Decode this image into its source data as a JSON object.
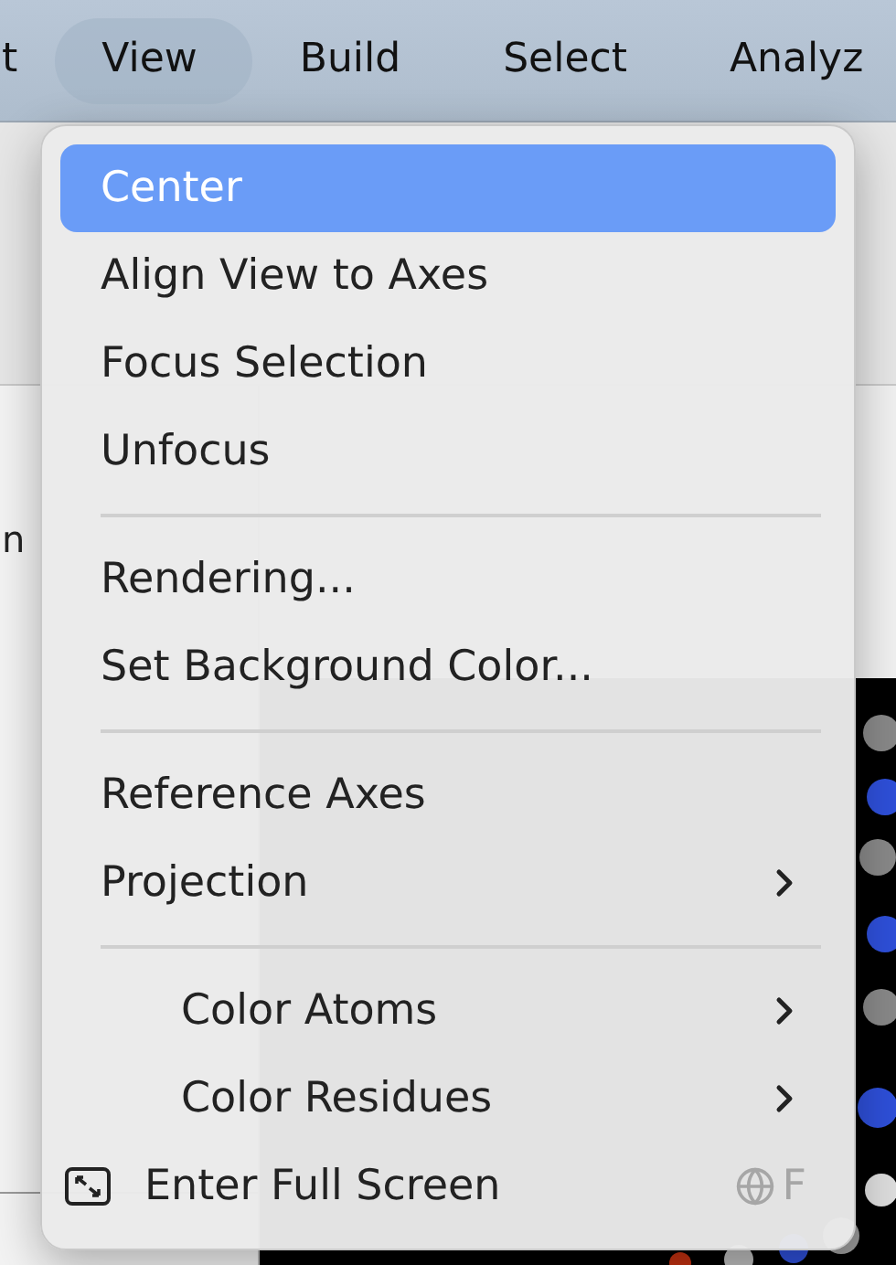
{
  "menubar": [
    {
      "label": "t",
      "selected": false
    },
    {
      "label": "View",
      "selected": true
    },
    {
      "label": "Build",
      "selected": false
    },
    {
      "label": "Select",
      "selected": false
    },
    {
      "label": "Analyz",
      "selected": false
    }
  ],
  "side_panel": {
    "text": "n"
  },
  "menu": [
    {
      "kind": "item",
      "label": "Center",
      "highlighted": true
    },
    {
      "kind": "item",
      "label": "Align View to Axes",
      "highlighted": false
    },
    {
      "kind": "item",
      "label": "Focus Selection",
      "highlighted": false
    },
    {
      "kind": "item",
      "label": "Unfocus",
      "highlighted": false
    },
    {
      "kind": "separator"
    },
    {
      "kind": "item",
      "label": "Rendering...",
      "highlighted": false
    },
    {
      "kind": "item",
      "label": "Set Background Color...",
      "highlighted": false
    },
    {
      "kind": "separator"
    },
    {
      "kind": "item",
      "label": "Reference Axes",
      "highlighted": false
    },
    {
      "kind": "submenu",
      "label": "Projection",
      "highlighted": false
    },
    {
      "kind": "separator"
    },
    {
      "kind": "submenu",
      "label": "Color Atoms",
      "highlighted": false,
      "indented": true
    },
    {
      "kind": "submenu",
      "label": "Color Residues",
      "highlighted": false,
      "indented": true
    },
    {
      "kind": "fullscreen",
      "label": "Enter Full Screen",
      "highlighted": false,
      "shortcut": "F"
    }
  ]
}
